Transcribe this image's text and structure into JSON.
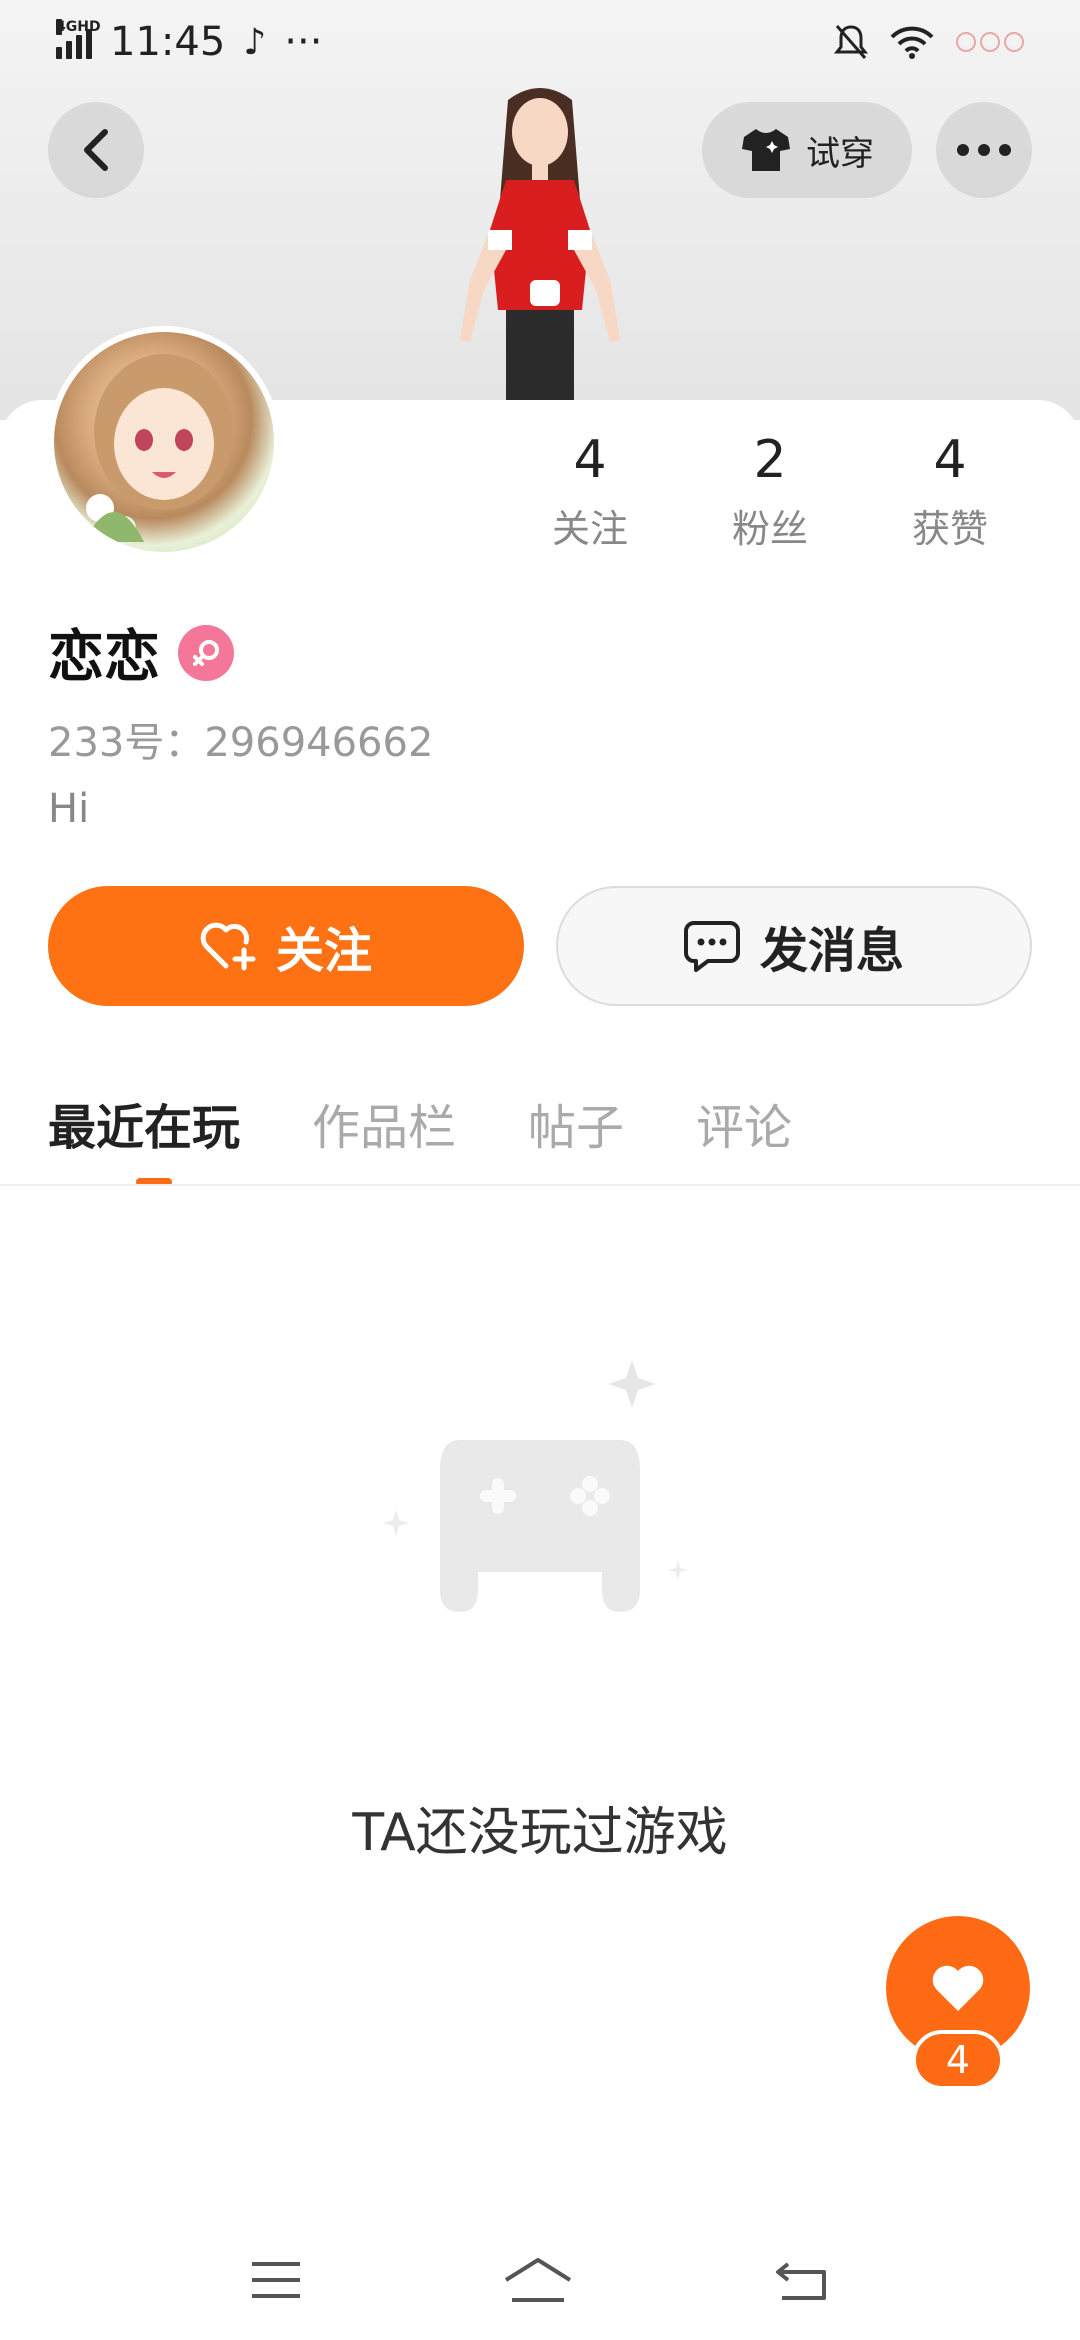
{
  "status_bar": {
    "network": "4GHD",
    "time": "11:45",
    "more": "···"
  },
  "header": {
    "try_on_label": "试穿"
  },
  "profile": {
    "name": "恋恋",
    "id_line": "233号：296946662",
    "bio": "Hi",
    "stats": [
      {
        "value": "4",
        "label": "关注"
      },
      {
        "value": "2",
        "label": "粉丝"
      },
      {
        "value": "4",
        "label": "获赞"
      }
    ]
  },
  "actions": {
    "follow_label": "关注",
    "message_label": "发消息"
  },
  "tabs": [
    "最近在玩",
    "作品栏",
    "帖子",
    "评论"
  ],
  "empty_state": {
    "text": "TA还没玩过游戏"
  },
  "like_fab": {
    "count": "4"
  },
  "colors": {
    "accent": "#ff6a14",
    "follow_button": "#ff7214",
    "gender_badge": "#f4779a"
  }
}
